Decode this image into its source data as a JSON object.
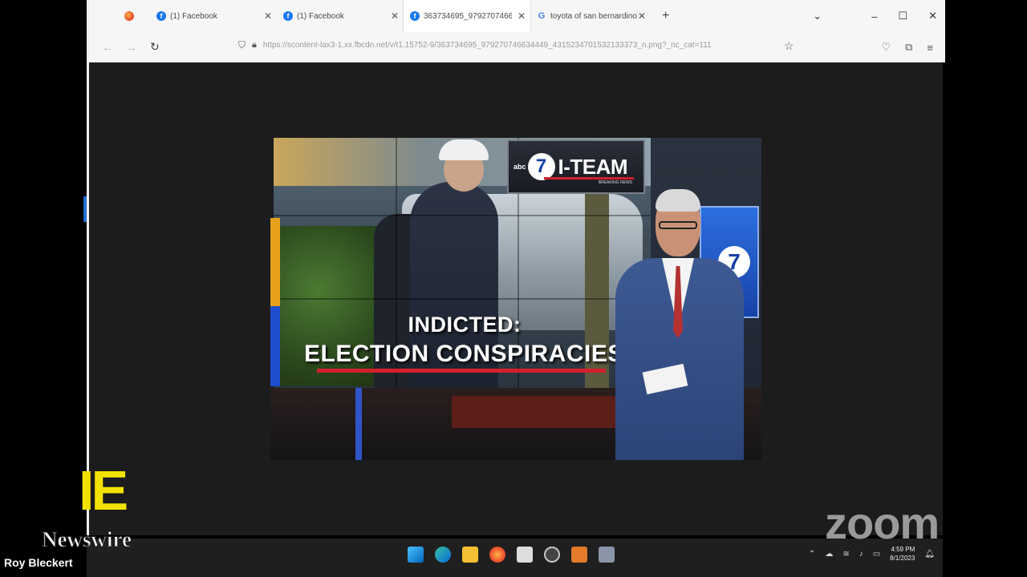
{
  "browser": {
    "tabs": [
      {
        "label": "(1) Facebook",
        "favicon": "facebook-icon"
      },
      {
        "label": "(1) Facebook",
        "favicon": "facebook-icon"
      },
      {
        "label": "363734695_979270746634...",
        "favicon": "facebook-icon",
        "active": true
      },
      {
        "label": "toyota of san bernardino -",
        "favicon": "google-icon"
      }
    ],
    "url": "https://scontent-lax3-1.xx.fbcdn.net/v/t1.15752-9/363734695_979270746634449_4315234701532133373_n.png?_nc_cat=111",
    "accent": "#1877f2"
  },
  "broadcast": {
    "headline_line1": "INDICTED:",
    "headline_line2": "ELECTION CONSPIRACIES",
    "bug_network": "abc",
    "bug_number": "7",
    "bug_title": "I-TEAM",
    "bug_sub": "BREAKING NEWS",
    "accent_red": "#d3202c"
  },
  "overlay": {
    "brand_letters": "IE",
    "brand_name": "Newswire",
    "zoom_logo": "zoom",
    "participant_name": "Roy Bleckert"
  },
  "taskbar": {
    "time": "4:59 PM",
    "date": "8/1/2023"
  }
}
